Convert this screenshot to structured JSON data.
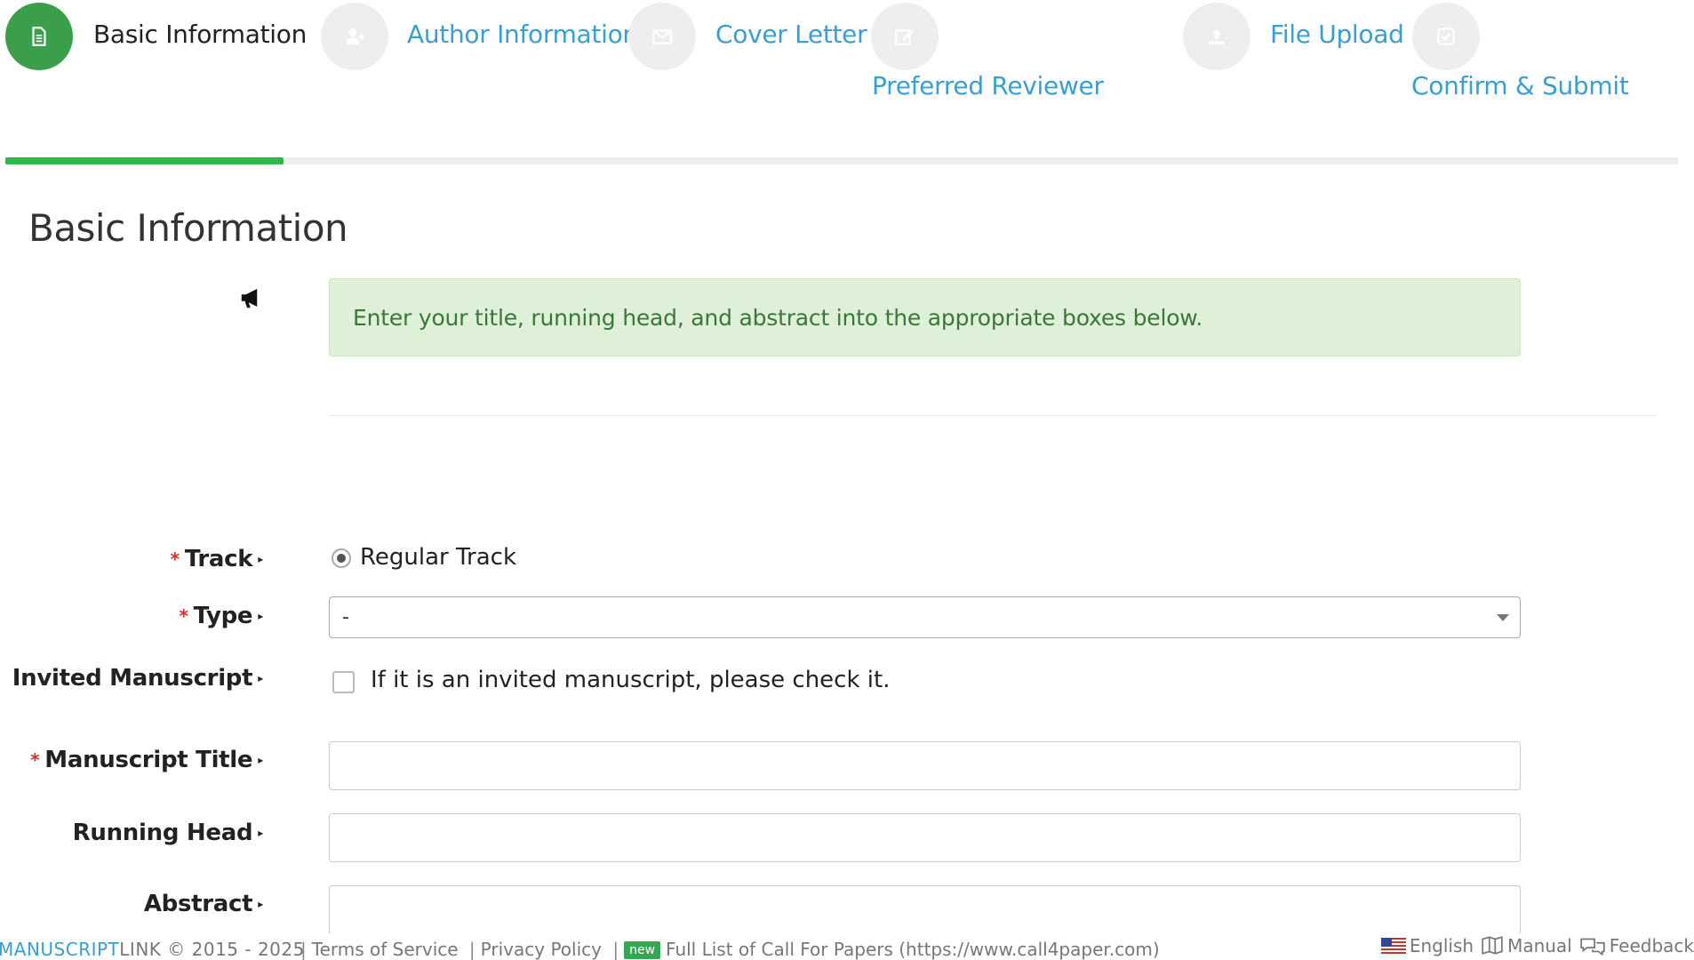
{
  "steps": [
    {
      "label": "Basic Information",
      "icon": "document-icon",
      "active": true
    },
    {
      "label": "Author Information",
      "icon": "add-user-icon",
      "active": false
    },
    {
      "label": "Cover Letter",
      "icon": "envelope-icon",
      "active": false
    },
    {
      "label": "Preferred Reviewer",
      "icon": "edit-icon",
      "active": false
    },
    {
      "label": "File Upload",
      "icon": "upload-icon",
      "active": false
    },
    {
      "label": "Confirm & Submit",
      "icon": "check-icon",
      "active": false
    }
  ],
  "progress": {
    "completed_steps": 1,
    "total_steps": 6,
    "fill_color": "#32b54a"
  },
  "page": {
    "title": "Basic Information",
    "notice": "Enter your title, running head, and abstract into the appropriate boxes below."
  },
  "form": {
    "track": {
      "label": "Track",
      "required": true,
      "option": "Regular Track",
      "selected": true
    },
    "type": {
      "label": "Type",
      "required": true,
      "value": "-"
    },
    "invited": {
      "label": "Invited Manuscript",
      "required": false,
      "checkbox_text": "If it is an invited manuscript, please check it.",
      "checked": false
    },
    "title": {
      "label": "Manuscript Title",
      "required": true,
      "value": ""
    },
    "running_head": {
      "label": "Running Head",
      "required": false,
      "value": ""
    },
    "abstract": {
      "label": "Abstract",
      "required": false,
      "value": ""
    },
    "required_mark": "*"
  },
  "footer": {
    "brand_part1": "MANUSCRIPT",
    "brand_part2": "LINK",
    "copyright": "© 2015 - 2025",
    "terms": "Terms of Service",
    "privacy": "Privacy Policy",
    "new_badge": "new",
    "cfp": "Full List of Call For Papers (https://www.call4paper.com)",
    "language": "English",
    "manual": "Manual",
    "feedback": "Feedback"
  },
  "colors": {
    "accent_green": "#3a9e4a",
    "link_blue": "#3a9fd0",
    "notice_bg": "#dff0d8",
    "notice_text": "#3c763d",
    "required_red": "#d0312d"
  }
}
